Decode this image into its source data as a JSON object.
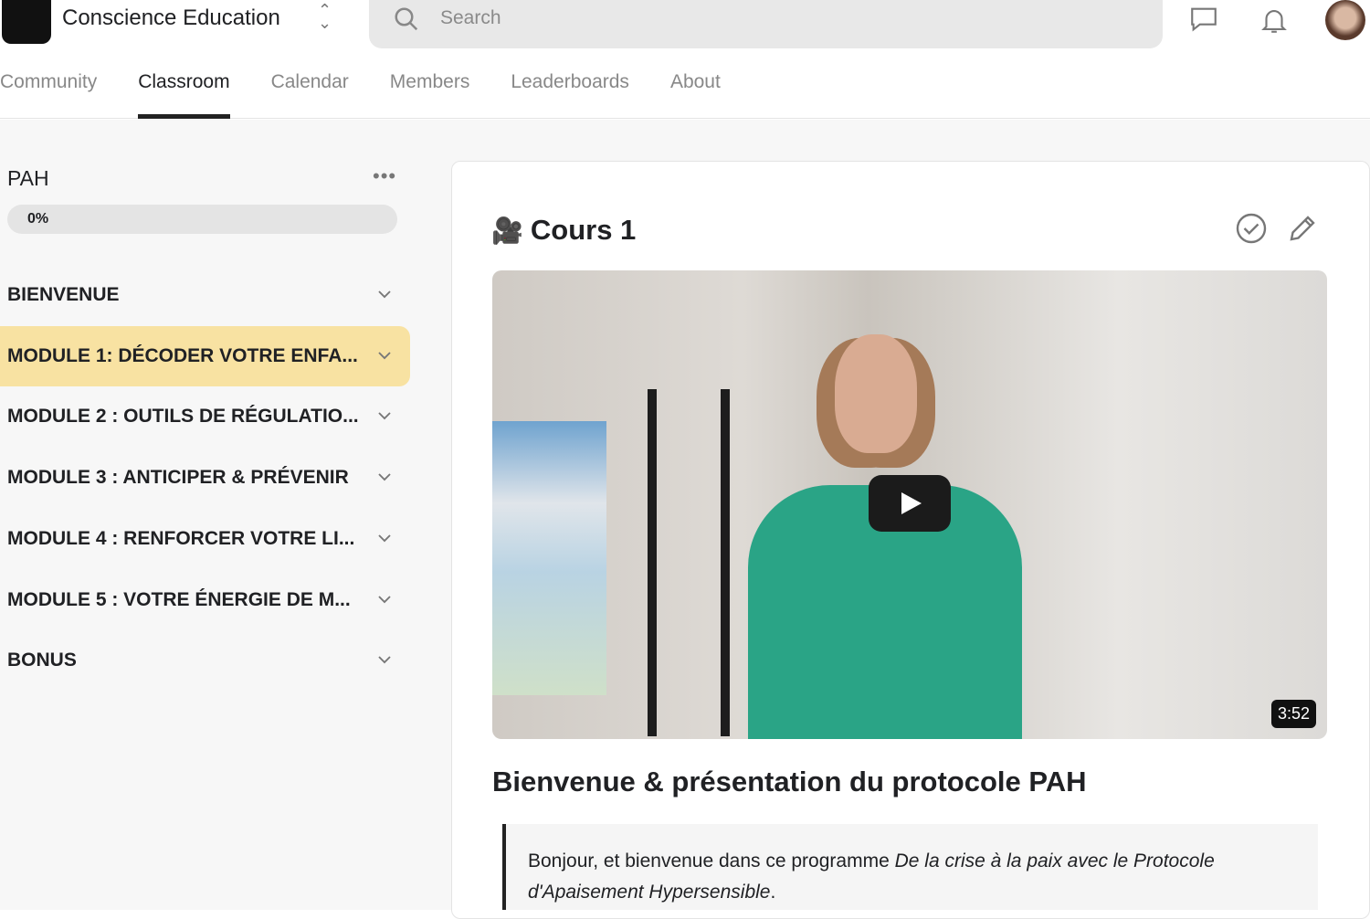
{
  "header": {
    "brand": "Conscience Education",
    "search_placeholder": "Search"
  },
  "tabs": [
    {
      "label": "Community"
    },
    {
      "label": "Classroom"
    },
    {
      "label": "Calendar"
    },
    {
      "label": "Members"
    },
    {
      "label": "Leaderboards"
    },
    {
      "label": "About"
    }
  ],
  "sidebar": {
    "course_title": "PAH",
    "progress_label": "0%",
    "progress": 0,
    "modules": [
      {
        "label": "BIENVENUE"
      },
      {
        "label": "MODULE 1: DÉCODER VOTRE ENFA..."
      },
      {
        "label": "MODULE 2 : OUTILS DE RÉGULATIO..."
      },
      {
        "label": "MODULE 3 : ANTICIPER & PRÉVENIR"
      },
      {
        "label": "MODULE 4 : RENFORCER VOTRE LI..."
      },
      {
        "label": "MODULE 5 : VOTRE ÉNERGIE DE M..."
      },
      {
        "label": "BONUS"
      }
    ]
  },
  "lesson": {
    "emoji": "🎥",
    "title": "Cours 1",
    "duration": "3:52",
    "heading": "Bienvenue & présentation du protocole PAH",
    "quote_text": "Bonjour, et bienvenue dans ce programme ",
    "quote_italic": "De la crise à la paix avec le Protocole d'Apaisement Hypersensible",
    "quote_end": "."
  }
}
